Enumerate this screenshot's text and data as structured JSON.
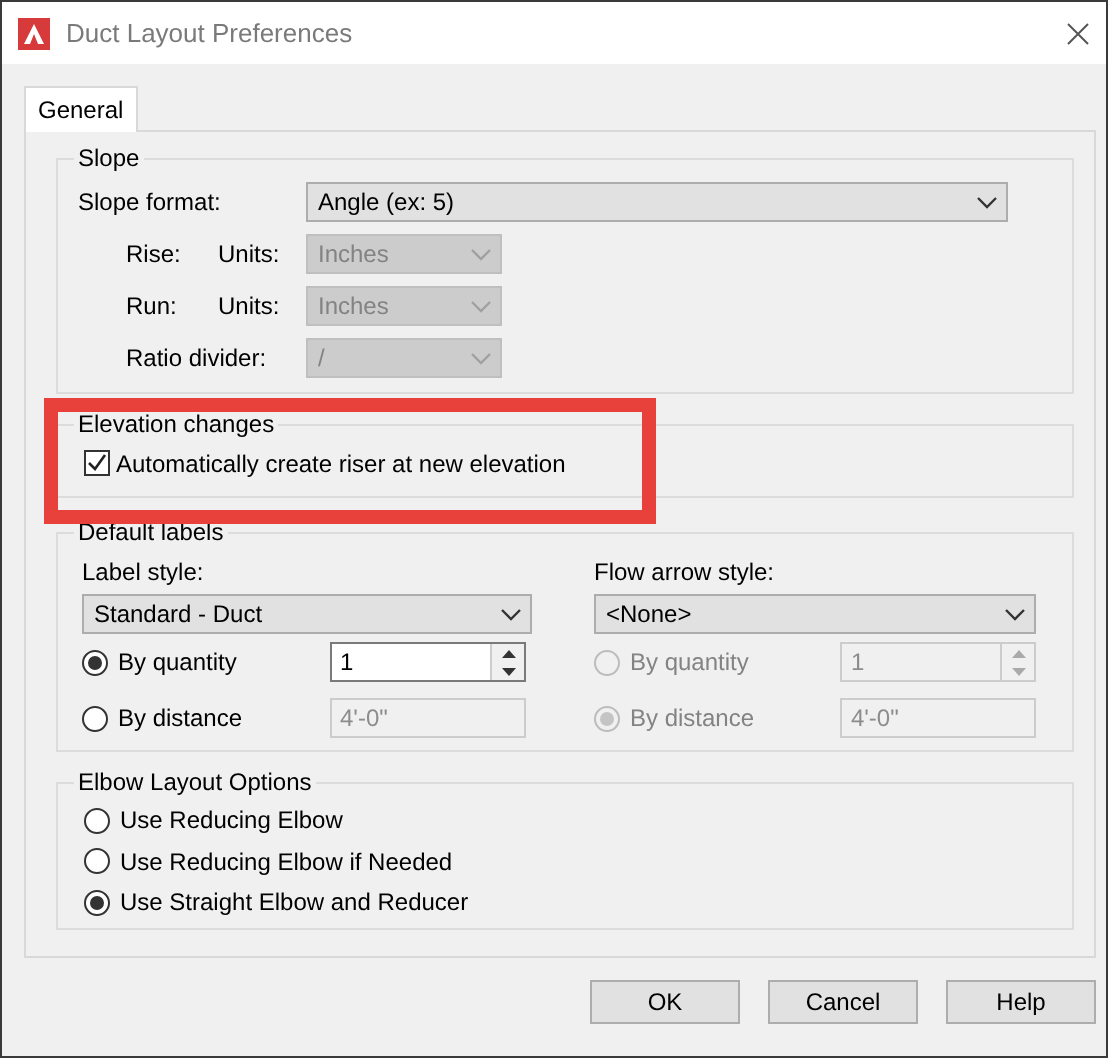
{
  "window": {
    "title": "Duct Layout Preferences"
  },
  "tabs": [
    {
      "label": "General",
      "selected": true
    }
  ],
  "slope": {
    "title": "Slope",
    "format": {
      "label": "Slope format:",
      "value": "Angle (ex: 5)",
      "disabled": false
    },
    "rows": [
      {
        "label": "Rise:",
        "units_label": "Units:",
        "value": "Inches",
        "disabled": true
      },
      {
        "label": "Run:",
        "units_label": "Units:",
        "value": "Inches",
        "disabled": true
      },
      {
        "label": "Ratio divider:",
        "value": "/",
        "disabled": true
      }
    ]
  },
  "elevation": {
    "title": "Elevation changes",
    "checkbox": {
      "label": "Automatically create riser at new elevation",
      "checked": true
    }
  },
  "default_labels": {
    "title": "Default labels",
    "columns": [
      {
        "label": "Label style:",
        "dropdown": {
          "value": "Standard - Duct",
          "disabled": false
        },
        "options": [
          {
            "label": "By quantity",
            "selected": true,
            "disabled": false,
            "kind": "spinner",
            "value": "1",
            "field_disabled": false
          },
          {
            "label": "By distance",
            "selected": false,
            "disabled": false,
            "kind": "field",
            "value": "4'-0\"",
            "field_disabled": true
          }
        ]
      },
      {
        "label": "Flow arrow style:",
        "dropdown": {
          "value": "<None>",
          "disabled": false
        },
        "options": [
          {
            "label": "By quantity",
            "selected": false,
            "disabled": true,
            "kind": "spinner",
            "value": "1",
            "field_disabled": true
          },
          {
            "label": "By distance",
            "selected": true,
            "disabled": true,
            "kind": "field",
            "value": "4'-0\"",
            "field_disabled": true
          }
        ]
      }
    ]
  },
  "elbow": {
    "title": "Elbow Layout Options",
    "options": [
      {
        "label": "Use Reducing Elbow",
        "selected": false
      },
      {
        "label": "Use Reducing Elbow if Needed",
        "selected": false
      },
      {
        "label": "Use Straight Elbow and Reducer",
        "selected": true
      }
    ]
  },
  "buttons": [
    "OK",
    "Cancel",
    "Help"
  ],
  "highlight": {
    "kind": "rectangle"
  }
}
